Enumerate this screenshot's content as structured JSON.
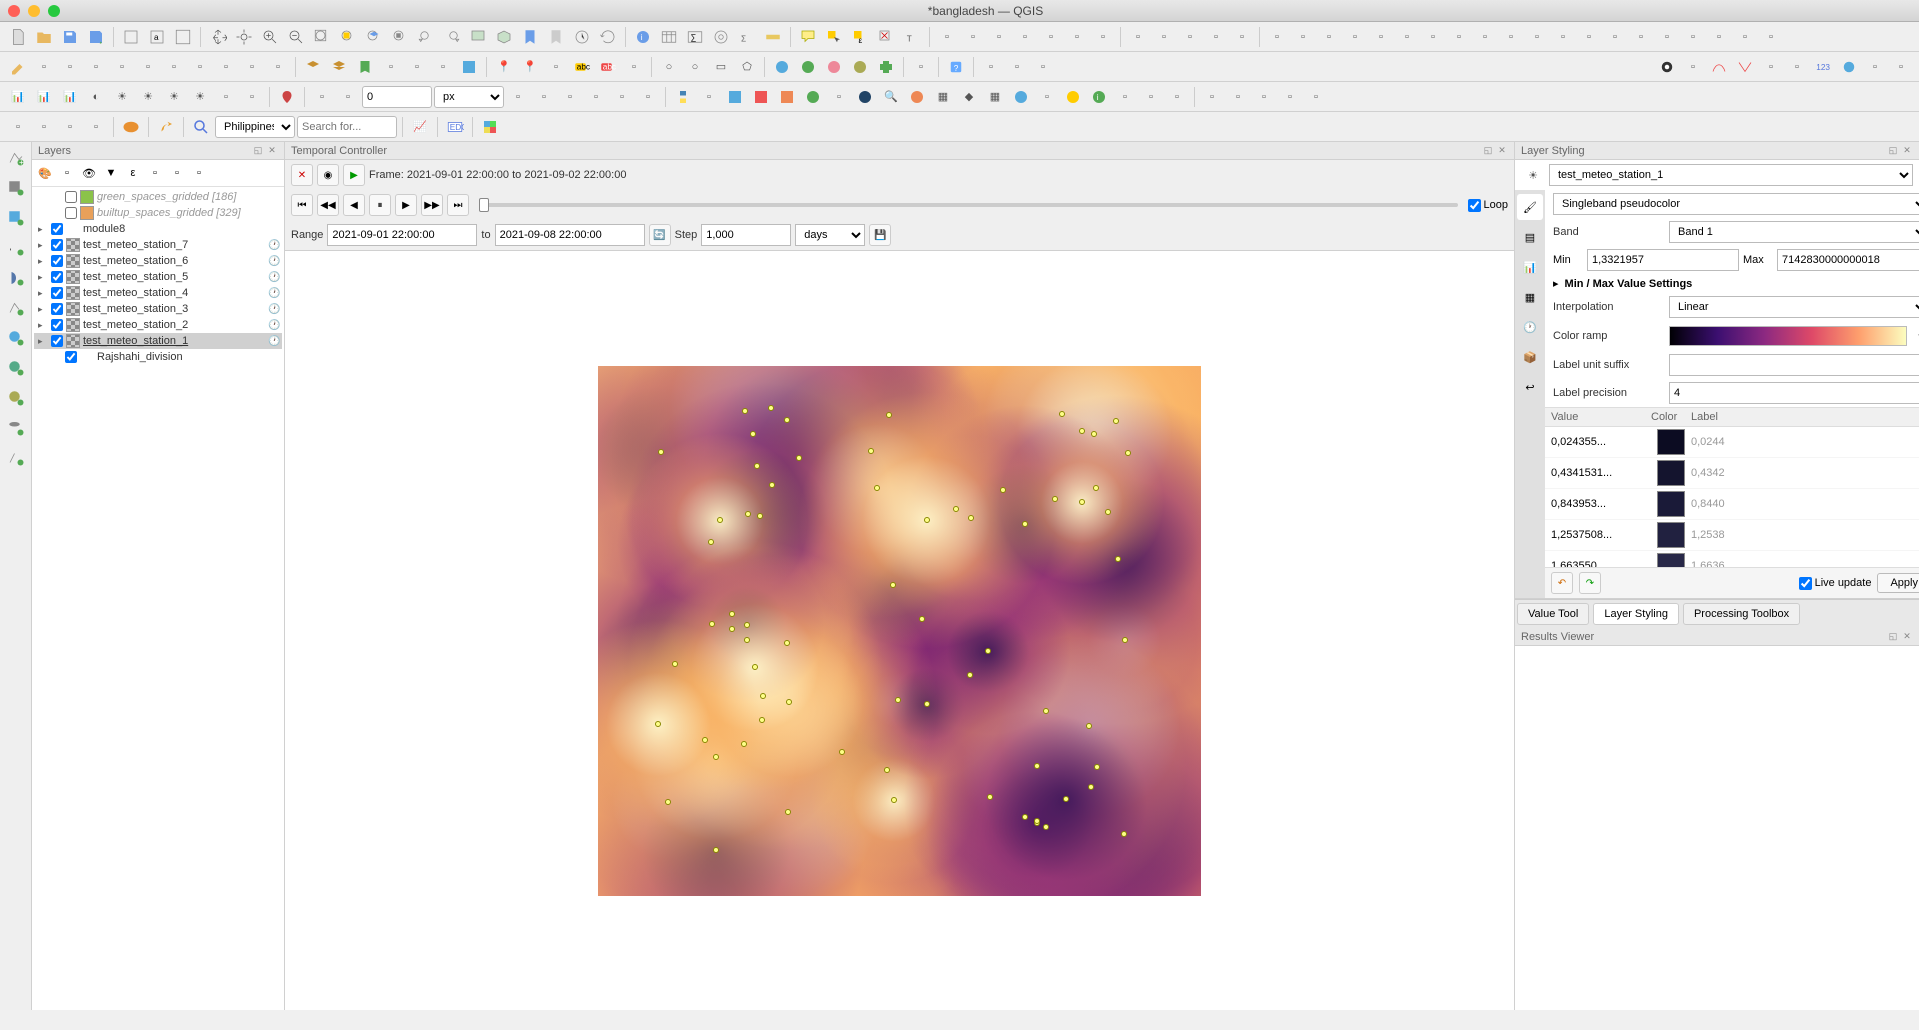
{
  "window": {
    "title": "*bangladesh — QGIS"
  },
  "toolbar4": {
    "location_filter": "Philippines",
    "search_placeholder": "Search for..."
  },
  "spinbox": {
    "value": "0",
    "unit": "px"
  },
  "layers_panel": {
    "title": "Layers",
    "items": [
      {
        "name": "green_spaces_gridded [186]",
        "checked": false,
        "italic": true,
        "color": "#8bc34a",
        "indent": 1
      },
      {
        "name": "builtup_spaces_gridded [329]",
        "checked": false,
        "italic": true,
        "color": "#e8a05a",
        "indent": 1
      },
      {
        "name": "module8",
        "checked": true,
        "expandable": true,
        "indent": 0,
        "group": true
      },
      {
        "name": "test_meteo_station_7",
        "checked": true,
        "raster": true,
        "clock": true,
        "expandable": true,
        "indent": 0
      },
      {
        "name": "test_meteo_station_6",
        "checked": true,
        "raster": true,
        "clock": true,
        "expandable": true,
        "indent": 0
      },
      {
        "name": "test_meteo_station_5",
        "checked": true,
        "raster": true,
        "clock": true,
        "expandable": true,
        "indent": 0
      },
      {
        "name": "test_meteo_station_4",
        "checked": true,
        "raster": true,
        "clock": true,
        "expandable": true,
        "indent": 0
      },
      {
        "name": "test_meteo_station_3",
        "checked": true,
        "raster": true,
        "clock": true,
        "expandable": true,
        "indent": 0
      },
      {
        "name": "test_meteo_station_2",
        "checked": true,
        "raster": true,
        "clock": true,
        "expandable": true,
        "indent": 0
      },
      {
        "name": "test_meteo_station_1",
        "checked": true,
        "raster": true,
        "clock": true,
        "expandable": true,
        "indent": 0,
        "selected": true,
        "underline": true
      },
      {
        "name": "Rajshahi_division",
        "checked": true,
        "indent": 1
      }
    ]
  },
  "temporal": {
    "title": "Temporal Controller",
    "frame_label": "Frame: 2021-09-01 22:00:00 to 2021-09-02 22:00:00",
    "loop_label": "Loop",
    "range_label": "Range",
    "range_start": "2021-09-01 22:00:00",
    "to_label": "to",
    "range_end": "2021-09-08 22:00:00",
    "step_label": "Step",
    "step_value": "1,000",
    "step_unit": "days"
  },
  "styling": {
    "title": "Layer Styling",
    "layer": "test_meteo_station_1",
    "renderer": "Singleband pseudocolor",
    "band_label": "Band",
    "band_value": "Band 1",
    "min_label": "Min",
    "min_value": "1,3321957",
    "max_label": "Max",
    "max_value": "7142830000000018",
    "minmax_settings": "Min / Max Value Settings",
    "interp_label": "Interpolation",
    "interp_value": "Linear",
    "ramp_label": "Color ramp",
    "suffix_label": "Label unit suffix",
    "suffix_value": "",
    "precision_label": "Label precision",
    "precision_value": "4",
    "table_headers": {
      "value": "Value",
      "color": "Color",
      "label": "Label"
    },
    "color_rows": [
      {
        "value": "0,024355...",
        "color": "#0c0c22",
        "label": "0,0244"
      },
      {
        "value": "0,4341531...",
        "color": "#14142e",
        "label": "0,4342"
      },
      {
        "value": "0,843953...",
        "color": "#1a1a38",
        "label": "0,8440"
      },
      {
        "value": "1,2537508...",
        "color": "#212140",
        "label": "1,2538"
      },
      {
        "value": "1,663550...",
        "color": "#282848",
        "label": "1,6636"
      }
    ],
    "live_update": "Live update",
    "apply": "Apply"
  },
  "bottom_tabs": {
    "value_tool": "Value Tool",
    "layer_styling": "Layer Styling",
    "processing": "Processing Toolbox"
  },
  "results": {
    "title": "Results Viewer"
  }
}
